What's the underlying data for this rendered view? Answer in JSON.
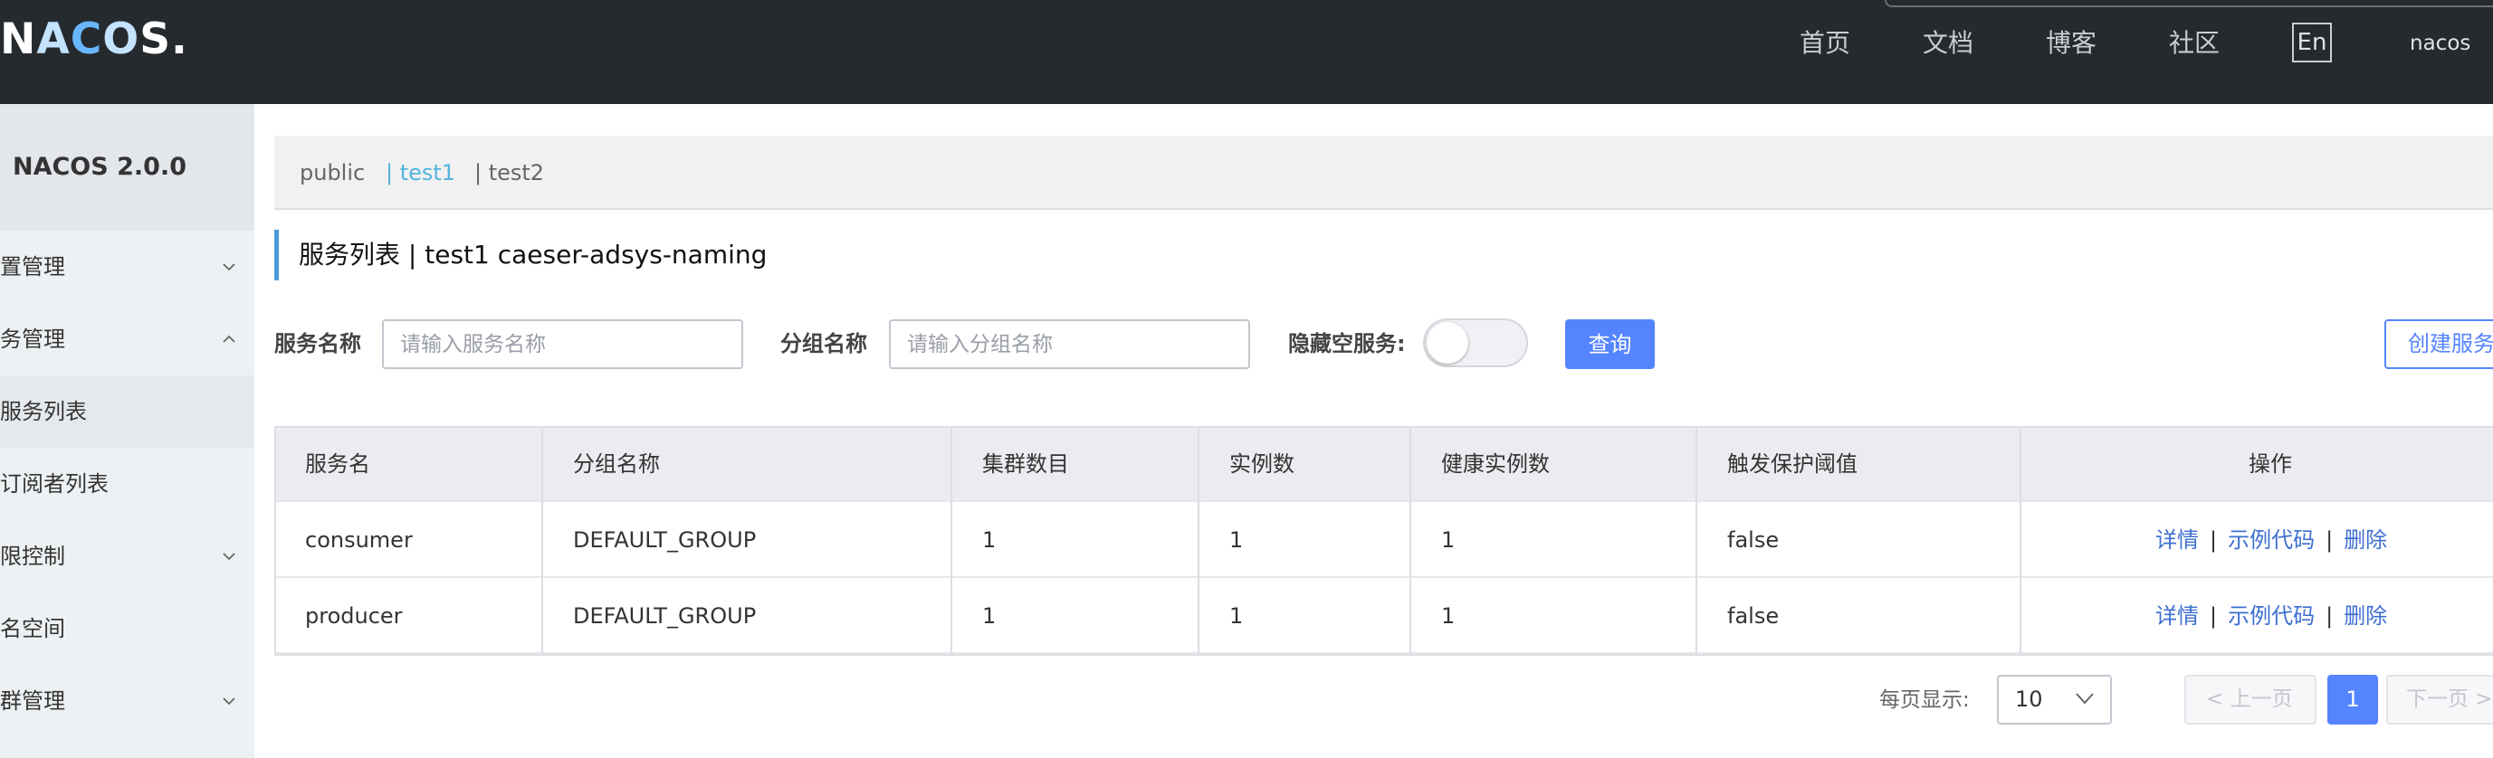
{
  "header": {
    "logo_text": "NACOS.",
    "nav": [
      "首页",
      "文档",
      "博客",
      "社区"
    ],
    "lang_button": "En",
    "user": "nacos"
  },
  "sidebar": {
    "title": "NACOS 2.0.0",
    "items": [
      {
        "label": "置管理",
        "expandable": true,
        "expanded": false
      },
      {
        "label": "务管理",
        "expandable": true,
        "expanded": true
      },
      {
        "label": "服务列表",
        "sub": true,
        "active": true
      },
      {
        "label": "订阅者列表",
        "sub": true
      },
      {
        "label": "限控制",
        "expandable": true,
        "expanded": false
      },
      {
        "label": "名空间"
      },
      {
        "label": "群管理",
        "expandable": true,
        "expanded": false
      }
    ]
  },
  "namespaces": {
    "tabs": [
      "public",
      "| test1",
      "| test2"
    ],
    "active": "test1"
  },
  "page": {
    "heading": "服务列表  |  test1  caeser-adsys-naming"
  },
  "filters": {
    "service_label": "服务名称",
    "service_placeholder": "请输入服务名称",
    "group_label": "分组名称",
    "group_placeholder": "请输入分组名称",
    "hide_empty_label": "隐藏空服务:",
    "hide_empty_on": false,
    "query_button": "查询",
    "create_button": "创建服务"
  },
  "table": {
    "columns": [
      "服务名",
      "分组名称",
      "集群数目",
      "实例数",
      "健康实例数",
      "触发保护阈值",
      "操作"
    ],
    "rows": [
      {
        "name": "consumer",
        "group": "DEFAULT_GROUP",
        "clusters": "1",
        "instances": "1",
        "healthy": "1",
        "threshold": "false"
      },
      {
        "name": "producer",
        "group": "DEFAULT_GROUP",
        "clusters": "1",
        "instances": "1",
        "healthy": "1",
        "threshold": "false"
      }
    ],
    "actions": {
      "detail": "详情",
      "sample_code": "示例代码",
      "delete": "删除",
      "separator": "|"
    }
  },
  "pagination": {
    "per_page_label": "每页显示:",
    "per_page": "10",
    "prev": "< 上一页",
    "current": "1",
    "next": "下一页 >"
  },
  "colors": {
    "header_bg": "#252a2f",
    "primary": "#5584ff",
    "active_tab": "#53b3de",
    "link": "#3e6fcf"
  }
}
